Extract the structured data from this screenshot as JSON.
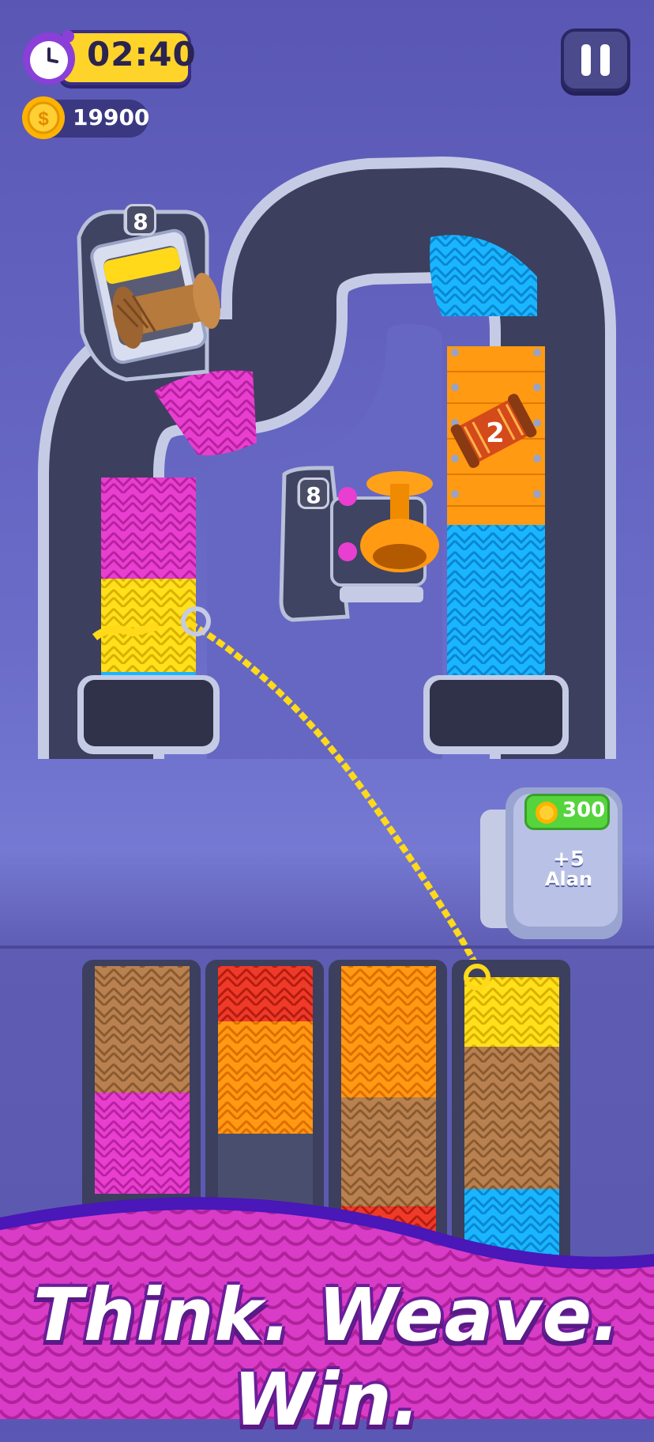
{
  "hud": {
    "timer": "02:40",
    "coins": "19900",
    "timer_icon": "alarm-clock-icon",
    "coin_icon": "coin-icon",
    "pause_icon": "pause-icon"
  },
  "board": {
    "spool_top_left_count": "8",
    "spool_middle_count": "8",
    "locked_spool_count": "2"
  },
  "shop": {
    "price": "300",
    "bonus": "+5",
    "name": "Alan"
  },
  "banner": {
    "slogan": "Think. Weave. Win."
  },
  "colors": {
    "magenta": "#e83fd0",
    "yellow": "#ffe01a",
    "cyan": "#19b6ff",
    "orange": "#ff9a12",
    "brown": "#b98150",
    "red": "#ef3a2a",
    "tube": "#3c3f5e"
  }
}
